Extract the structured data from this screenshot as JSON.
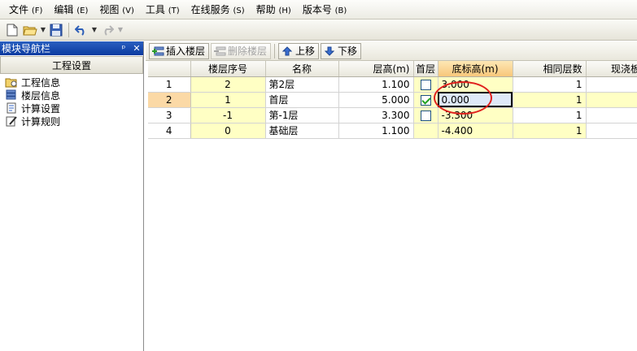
{
  "menu": {
    "items": [
      {
        "label": "文件",
        "accel": "(F)"
      },
      {
        "label": "编辑",
        "accel": "(E)"
      },
      {
        "label": "视图",
        "accel": "(V)"
      },
      {
        "label": "工具",
        "accel": "(T)"
      },
      {
        "label": "在线服务",
        "accel": "(S)"
      },
      {
        "label": "帮助",
        "accel": "(H)"
      },
      {
        "label": "版本号",
        "accel": "(B)"
      }
    ]
  },
  "toolbar": {
    "icons": [
      "new-file-icon",
      "open-folder-icon",
      "save-icon",
      "undo-icon",
      "redo-icon"
    ]
  },
  "nav": {
    "title": "模块导航栏",
    "pin_glyph": "ᵖ",
    "close_glyph": "✕",
    "header": "工程设置",
    "items": [
      {
        "label": "工程信息",
        "icon": "project-info-icon"
      },
      {
        "label": "楼层信息",
        "icon": "floor-info-icon"
      },
      {
        "label": "计算设置",
        "icon": "calc-settings-icon"
      },
      {
        "label": "计算规则",
        "icon": "calc-rules-icon"
      }
    ]
  },
  "grid_toolbar": {
    "insert_floor": "插入楼层",
    "delete_floor": "删除楼层",
    "move_up": "上移",
    "move_down": "下移"
  },
  "table": {
    "columns": [
      "",
      "楼层序号",
      "名称",
      "层高(m)",
      "首层",
      "底标高(m)",
      "相同层数",
      "现浇板厚"
    ],
    "rows": [
      {
        "row": "1",
        "floor_no": "2",
        "name": "第2层",
        "height": "1.100",
        "first": false,
        "base_elev": "3.000",
        "same_count": "1",
        "slab": ""
      },
      {
        "row": "2",
        "floor_no": "1",
        "name": "首层",
        "height": "5.000",
        "first": true,
        "base_elev": "0.000",
        "same_count": "1",
        "slab": ""
      },
      {
        "row": "3",
        "floor_no": "-1",
        "name": "第-1层",
        "height": "3.300",
        "first": false,
        "base_elev": "-3.300",
        "same_count": "1",
        "slab": ""
      },
      {
        "row": "4",
        "floor_no": "0",
        "name": "基础层",
        "height": "1.100",
        "first": null,
        "base_elev": "-4.400",
        "same_count": "1",
        "slab": ""
      }
    ]
  },
  "colors": {
    "nav_title_bg": "#0a3aa0",
    "yellow_cell": "#ffffc4",
    "current_row_header": "#fbd9a6",
    "annotation_red": "#e0211d"
  }
}
